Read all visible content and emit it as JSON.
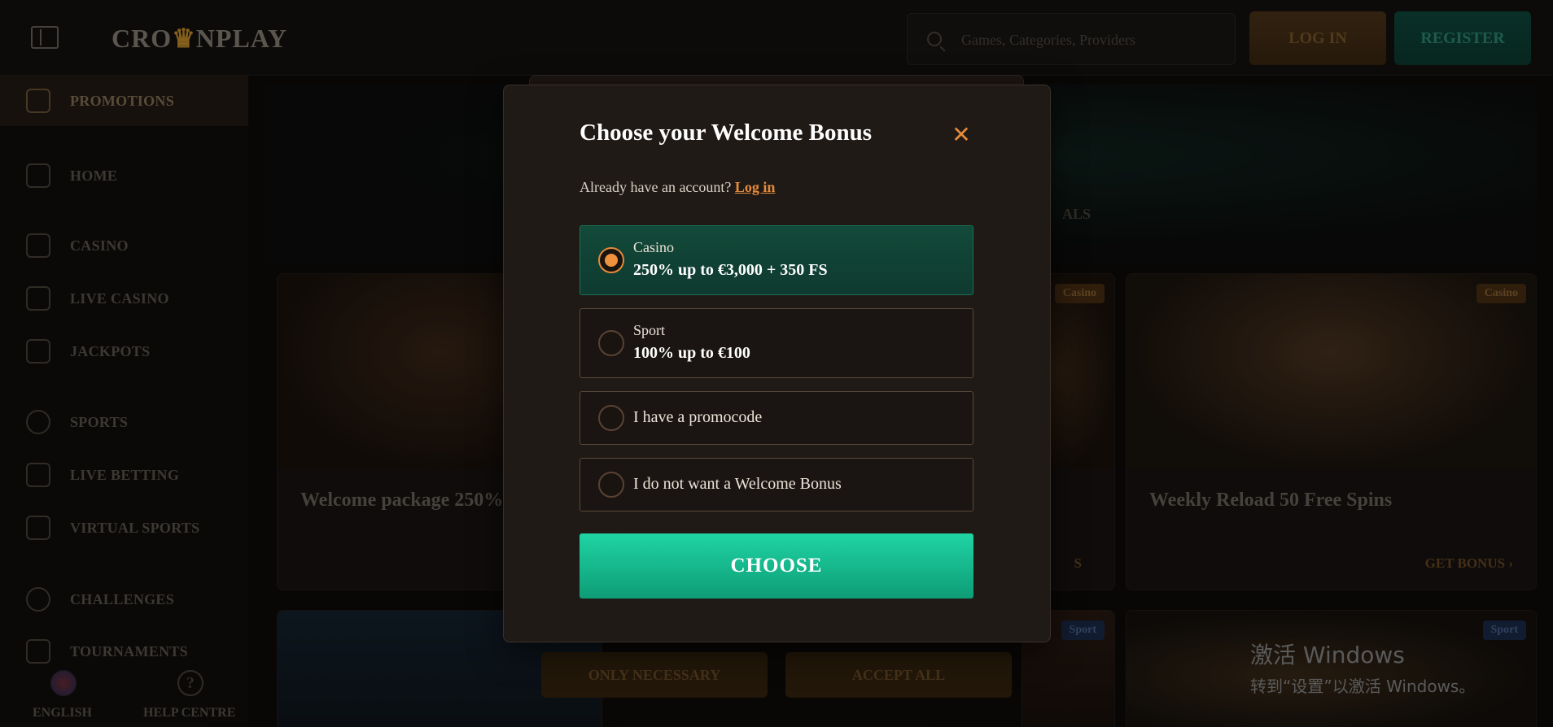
{
  "header": {
    "logo": "CROWNPLAY",
    "logo_left": "CRO",
    "logo_crown": "♛",
    "logo_right": "NPLAY",
    "search_placeholder": "Games, Categories, Providers",
    "login_label": "LOG IN",
    "register_label": "REGISTER"
  },
  "sidebar": {
    "items": [
      {
        "label": "PROMOTIONS",
        "icon": "gift-icon"
      },
      {
        "label": "HOME",
        "icon": "home-icon"
      },
      {
        "label": "CASINO",
        "icon": "slot-machine-icon"
      },
      {
        "label": "LIVE CASINO",
        "icon": "spade-icon"
      },
      {
        "label": "JACKPOTS",
        "icon": "clover-icon"
      },
      {
        "label": "SPORTS",
        "icon": "ball-icon"
      },
      {
        "label": "LIVE BETTING",
        "icon": "tv-icon"
      },
      {
        "label": "VIRTUAL SPORTS",
        "icon": "gamepad-icon"
      },
      {
        "label": "CHALLENGES",
        "icon": "medal-icon"
      },
      {
        "label": "TOURNAMENTS",
        "icon": "trophy-icon"
      }
    ],
    "language": "ENGLISH",
    "help": "HELP CENTRE"
  },
  "main": {
    "tab_fragment": "ALS",
    "cards": [
      {
        "title": "Welcome package 250% + 350 FS",
        "cta": ""
      },
      {
        "title": "",
        "cta": "S",
        "badge": "Casino"
      },
      {
        "title": "Weekly Reload 50 Free Spins",
        "cta": "GET BONUS",
        "badge": "Casino"
      }
    ],
    "bottom_badges": [
      "Sport",
      "Sport"
    ],
    "cookie": {
      "necessary": "ONLY NECESSARY",
      "accept": "ACCEPT ALL"
    }
  },
  "modal": {
    "title": "Choose your Welcome Bonus",
    "account_text": "Already have an account?",
    "login_link": "Log in",
    "options": [
      {
        "sub": "Casino",
        "main": "250% up to €3,000 + 350 FS",
        "selected": true
      },
      {
        "sub": "Sport",
        "main": "100% up to €100",
        "selected": false
      },
      {
        "label": "I have a promocode",
        "selected": false
      },
      {
        "label": "I do not want a Welcome Bonus",
        "selected": false
      }
    ],
    "choose_label": "CHOOSE"
  },
  "watermark": {
    "line1": "激活 Windows",
    "line2": "转到“设置”以激活 Windows。"
  },
  "colors": {
    "accent_orange": "#e58a3a",
    "accent_green": "#1fd4a4",
    "selected_bg": "#124a3a"
  }
}
